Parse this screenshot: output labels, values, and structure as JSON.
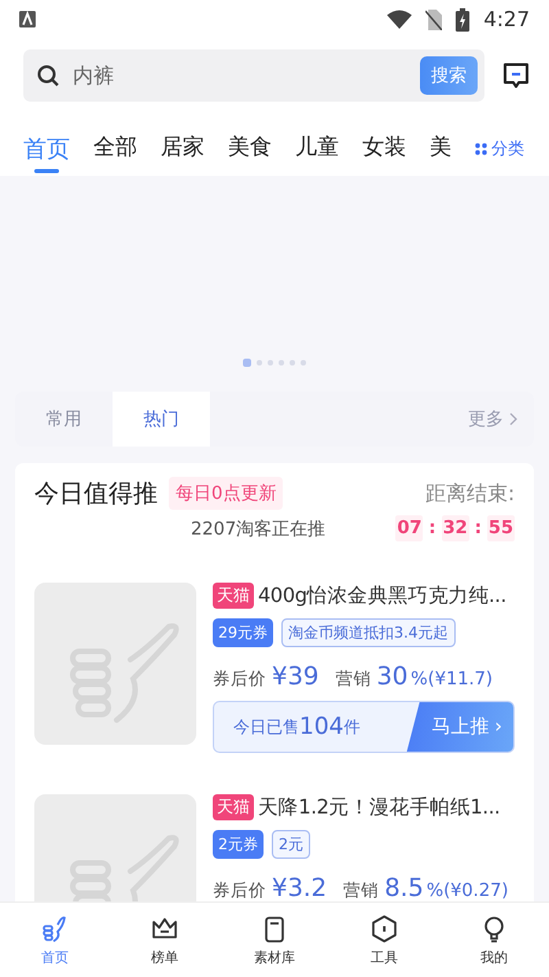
{
  "status_bar": {
    "time": "4:27"
  },
  "search": {
    "value": "内裤",
    "button": "搜索"
  },
  "categories": [
    {
      "label": "首页",
      "selected": true
    },
    {
      "label": "全部",
      "selected": false
    },
    {
      "label": "居家",
      "selected": false
    },
    {
      "label": "美食",
      "selected": false
    },
    {
      "label": "儿童",
      "selected": false
    },
    {
      "label": "女装",
      "selected": false
    },
    {
      "label": "美",
      "selected": false
    }
  ],
  "category_more": "分类",
  "banner": {
    "dots": [
      {
        "selected": true
      },
      {
        "selected": false
      },
      {
        "selected": false
      },
      {
        "selected": false
      },
      {
        "selected": false
      },
      {
        "selected": false
      }
    ]
  },
  "section_tabs": [
    {
      "label": "常用",
      "selected": false
    },
    {
      "label": "热门",
      "selected": true
    }
  ],
  "section_more": "更多",
  "recommend": {
    "title": "今日值得推",
    "badge": "每日0点更新",
    "promoters": "2207淘客正在推",
    "countdown_label": "距离结束:",
    "countdown": [
      "07",
      "32",
      "55"
    ],
    "separators": [
      ":",
      ":"
    ]
  },
  "products": [
    {
      "shop": "天猫",
      "title": "400g怡浓金典黑巧克力纯...",
      "coupon": "29元券",
      "offer": "淘金币频道抵扣3.4元起",
      "price_label": "券后价",
      "price": "¥39",
      "commission_label": "营销",
      "commission": "30",
      "commission_tail": "%(¥11.7)",
      "sold_prefix": "今日已售",
      "sold": "104",
      "sold_unit": "件",
      "action": "马上推",
      "action_icon": "›"
    },
    {
      "shop": "天猫",
      "title": "天降1.2元！漫花手帕纸1...",
      "coupon": "2元券",
      "offer": "2元",
      "price_label": "券后价",
      "price": "¥3.2",
      "commission_label": "营销",
      "commission": "8.5",
      "commission_tail": "%(¥0.27)"
    }
  ],
  "nav": [
    {
      "label": "首页",
      "selected": true
    },
    {
      "label": "榜单",
      "selected": false
    },
    {
      "label": "素材库",
      "selected": false
    },
    {
      "label": "工具",
      "selected": false
    },
    {
      "label": "我的",
      "selected": false
    }
  ]
}
